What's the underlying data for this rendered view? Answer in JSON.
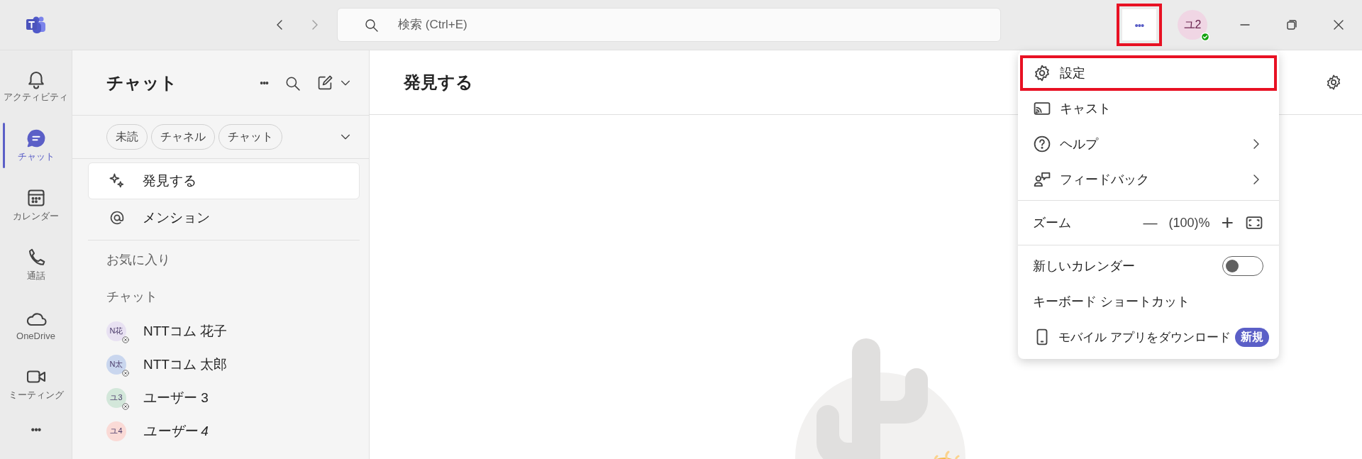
{
  "title_bar": {
    "search": {
      "placeholder": "検索 (Ctrl+E)"
    },
    "more_button": {
      "label": "•••",
      "highlighted": true
    },
    "avatar": {
      "initials": "ユ2",
      "color": "#f0d6e4",
      "available": true
    }
  },
  "rail": [
    {
      "kind": "activity",
      "label": "アクティビティ",
      "selected": false
    },
    {
      "kind": "chat",
      "label": "チャット",
      "selected": true
    },
    {
      "kind": "calendar",
      "label": "カレンダー",
      "selected": false
    },
    {
      "kind": "calls",
      "label": "通話",
      "selected": false
    },
    {
      "kind": "onedrive",
      "label": "OneDrive",
      "selected": false
    },
    {
      "kind": "meetings",
      "label": "ミーティング",
      "selected": false
    }
  ],
  "rail_more": "•••",
  "sidebar": {
    "title": "チャット",
    "more": "•••",
    "filters": [
      {
        "label": "未読",
        "selected": false
      },
      {
        "label": "チャネル",
        "selected": false
      },
      {
        "label": "チャット",
        "selected": false
      }
    ],
    "nav": [
      {
        "kind": "discover",
        "label": "発見する",
        "selected": true
      },
      {
        "kind": "mention",
        "label": "メンション",
        "selected": false
      }
    ],
    "favorites_heading": "お気に入り",
    "chats_heading": "チャット",
    "chats": [
      {
        "initials": "N花",
        "name": "NTTコム 花子",
        "color": "#e8e1f2",
        "available": false,
        "offline": true,
        "italic": false
      },
      {
        "initials": "N太",
        "name": "NTTコム 太郎",
        "color": "#c9d6ee",
        "available": false,
        "offline": true,
        "italic": false
      },
      {
        "initials": "ユ3",
        "name": "ユーザー 3",
        "color": "#d3e7da",
        "available": false,
        "offline": true,
        "italic": false
      },
      {
        "initials": "ユ4",
        "name": "ユーザー 4",
        "color": "#fadad6",
        "available": false,
        "offline": false,
        "italic": true
      }
    ]
  },
  "main": {
    "title": "発見する"
  },
  "menu": {
    "groups": [
      [
        {
          "kind": "settings",
          "label": "設定",
          "submenu": false,
          "highlighted": true
        },
        {
          "kind": "cast",
          "label": "キャスト",
          "submenu": false,
          "highlighted": false
        },
        {
          "kind": "help",
          "label": "ヘルプ",
          "submenu": true,
          "highlighted": false
        },
        {
          "kind": "feedback",
          "label": "フィードバック",
          "submenu": true,
          "highlighted": false
        }
      ],
      [
        {
          "kind": "zoom",
          "label": "ズーム",
          "minus": "—",
          "value": "(100)%",
          "plus": "+"
        }
      ],
      [
        {
          "kind": "toggle",
          "label": "新しいカレンダー",
          "on": false
        },
        {
          "kind": "plain",
          "label": "キーボード ショートカット",
          "submenu": false,
          "highlighted": false
        },
        {
          "kind": "download",
          "label": "モバイル アプリをダウンロード",
          "badge": "新規",
          "highlighted": false
        }
      ]
    ]
  }
}
